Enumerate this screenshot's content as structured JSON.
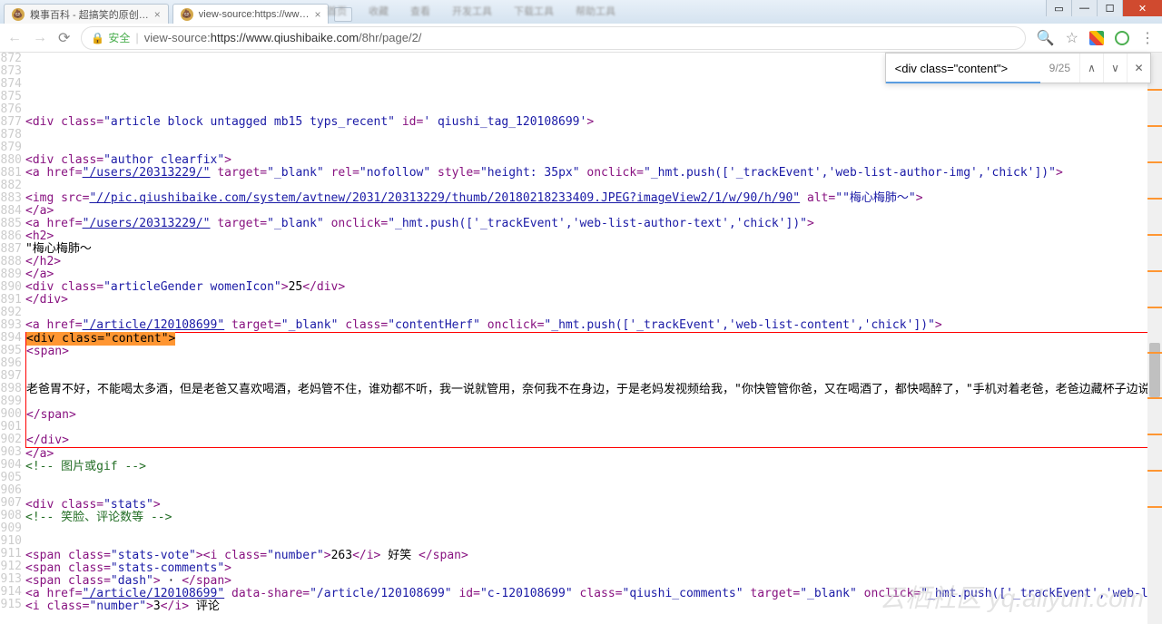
{
  "tabs": [
    {
      "title": "糗事百科 - 超搞笑的原创…"
    },
    {
      "title": "view-source:https://ww…"
    }
  ],
  "window_buttons": {
    "min": "—",
    "max": "☐",
    "close": "✕",
    "extra": "▭"
  },
  "toolbar": {
    "secure_label": "安全",
    "url_prefix": "view-source:",
    "url_host": "https://www.qiushibaike.com",
    "url_path": "/8hr/page/2/"
  },
  "findbar": {
    "query": "<div class=\"content\">",
    "count": "9/25"
  },
  "menu_blur": [
    "首页",
    "收藏",
    "查看",
    "开发工具",
    "下载工具",
    "帮助工具"
  ],
  "lines": {
    "start": 872,
    "end": 915,
    "l877": {
      "p1": "<div class=",
      "v1": "\"article block untagged mb15 typs_recent\"",
      "p2": " id=",
      "v2": "' qiushi_tag_120108699'",
      "p3": ">"
    },
    "l880": {
      "p1": "<div class=",
      "v1": "\"author clearfix\"",
      "p2": ">"
    },
    "l881": {
      "p1": "<a href=",
      "v1": "\"/users/20313229/\"",
      "p2": " target=",
      "v2": "\"_blank\"",
      "p3": " rel=",
      "v3": "\"nofollow\"",
      "p4": " style=",
      "v4": "\"height: 35px\"",
      "p5": " onclick=",
      "v5": "\"_hmt.push(['_trackEvent','web-list-author-img','chick'])\"",
      "p6": ">"
    },
    "l883": {
      "p1": "<img src=",
      "v1": "\"//pic.qiushibaike.com/system/avtnew/2031/20313229/thumb/20180218233409.JPEG?imageView2/1/w/90/h/90\"",
      "p2": " alt=",
      "v2": "\"\"梅心梅肺～\"",
      "p3": ">"
    },
    "l884": "</a>",
    "l885": {
      "p1": "<a href=",
      "v1": "\"/users/20313229/\"",
      "p2": " target=",
      "v2": "\"_blank\"",
      "p3": " onclick=",
      "v3": "\"_hmt.push(['_trackEvent','web-list-author-text','chick'])\"",
      "p4": ">"
    },
    "l886": "<h2>",
    "l887": "\"梅心梅肺～",
    "l888": "</h2>",
    "l889": "</a>",
    "l890": {
      "p1": "<div class=",
      "v1": "\"articleGender womenIcon\"",
      "p2": ">",
      "t": "25",
      "p3": "</div>"
    },
    "l891": "</div>",
    "l893": {
      "p1": "<a href=",
      "v1": "\"/article/120108699\"",
      "p2": " target=",
      "v2": "\"_blank\"",
      "p3": " class=",
      "v3": "\"contentHerf\"",
      "p4": " onclick=",
      "v4": "\"_hmt.push(['_trackEvent','web-list-content','chick'])\"",
      "p5": ">"
    },
    "l894": "<div class=\"content\">",
    "l895": "<span>",
    "l898": "老爸胃不好，不能喝太多酒，但是老爸又喜欢喝酒，老妈管不住，谁劝都不听，我一说就管用，奈何我不在身边，于是老妈发视频给我，\"你快管管你爸，又在喝酒了，都快喝醉了，\"手机对着老爸，老爸边藏杯子边说，我没喝，我喝的是白开水，我说老爸，你是不是觉得我近视严重了，还是老妈手机像素不好，以为我看不到呀？？老爸默默把杯子放下拿碗去盛饭吃┌[笑哭]┌[笑哭]",
    "l900": "</span>",
    "l902": "</div>",
    "l903": "</a>",
    "l904": "<!-- 图片或gif -->",
    "l907": {
      "p1": "<div class=",
      "v1": "\"stats\"",
      "p2": ">"
    },
    "l908": "<!-- 笑脸、评论数等 -->",
    "l911": {
      "p1": "<span class=",
      "v1": "\"stats-vote\"",
      "p2": "><i class=",
      "v2": "\"number\"",
      "p3": ">",
      "t1": "263",
      "p4": "</i>",
      "t2": " 好笑 ",
      "p5": "</span>"
    },
    "l912": {
      "p1": "<span class=",
      "v1": "\"stats-comments\"",
      "p2": ">"
    },
    "l913": {
      "p1": "<span class=",
      "v1": "\"dash\"",
      "p2": ">",
      "t": " · ",
      "p3": "</span>"
    },
    "l914": {
      "p1": "<a href=",
      "v1": "\"/article/120108699\"",
      "p2": " data-share=",
      "v2": "\"/article/120108699\"",
      "p3": " id=",
      "v3": "\"c-120108699\"",
      "p4": " class=",
      "v4": "\"qiushi_comments\"",
      "p5": " target=",
      "v5": "\"_blank\"",
      "p6": " onclick=",
      "v6": "\"_hmt.push(['_trackEvent','web-list-comment','chick'])\"",
      "p7": ">"
    },
    "l915": {
      "p1": "<i class=",
      "v1": "\"number\"",
      "p2": ">",
      "t1": "3",
      "p3": "</i>",
      "t2": " 评论"
    }
  },
  "watermark": "云栖社区 yq.aliyun.com"
}
